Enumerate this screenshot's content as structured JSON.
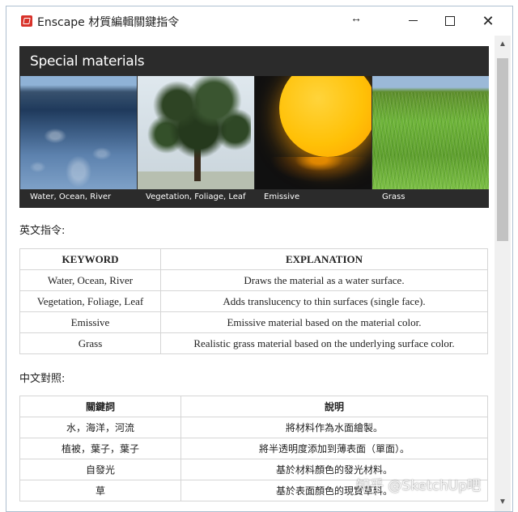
{
  "window": {
    "title": "Enscape 材質編輯關鍵指令",
    "resize_glyph": "↔",
    "minimize_icon": "minimize-icon",
    "maximize_icon": "maximize-icon",
    "close_glyph": "✕"
  },
  "banner": {
    "title": "Special materials",
    "tiles": [
      {
        "caption": "Water, Ocean, River",
        "icon": "water-image"
      },
      {
        "caption": "Vegetation, Foliage, Leaf",
        "icon": "tree-image"
      },
      {
        "caption": "Emissive",
        "icon": "glowing-sphere-image"
      },
      {
        "caption": "Grass",
        "icon": "grass-image"
      }
    ]
  },
  "english_section": {
    "label": "英文指令:",
    "headers": [
      "KEYWORD",
      "EXPLANATION"
    ],
    "rows": [
      [
        "Water, Ocean, River",
        "Draws the material as a water surface."
      ],
      [
        "Vegetation, Foliage, Leaf",
        "Adds translucency to thin surfaces (single face)."
      ],
      [
        "Emissive",
        "Emissive material based on the material color."
      ],
      [
        "Grass",
        "Realistic grass material based on the underlying surface color."
      ]
    ]
  },
  "chinese_section": {
    "label": "中文對照:",
    "headers": [
      "關鍵詞",
      "說明"
    ],
    "rows": [
      [
        "水，海洋，河流",
        "將材料作為水面繪製。"
      ],
      [
        "植被，葉子，葉子",
        "將半透明度添加到薄表面（單面）。"
      ],
      [
        "自發光",
        "基於材料顏色的發光材料。"
      ],
      [
        "草",
        "基於表面顏色的現實草料。"
      ]
    ]
  },
  "scrollbar": {
    "up_glyph": "▲",
    "down_glyph": "▼"
  },
  "watermark": "知乎 @SketchUp吧"
}
